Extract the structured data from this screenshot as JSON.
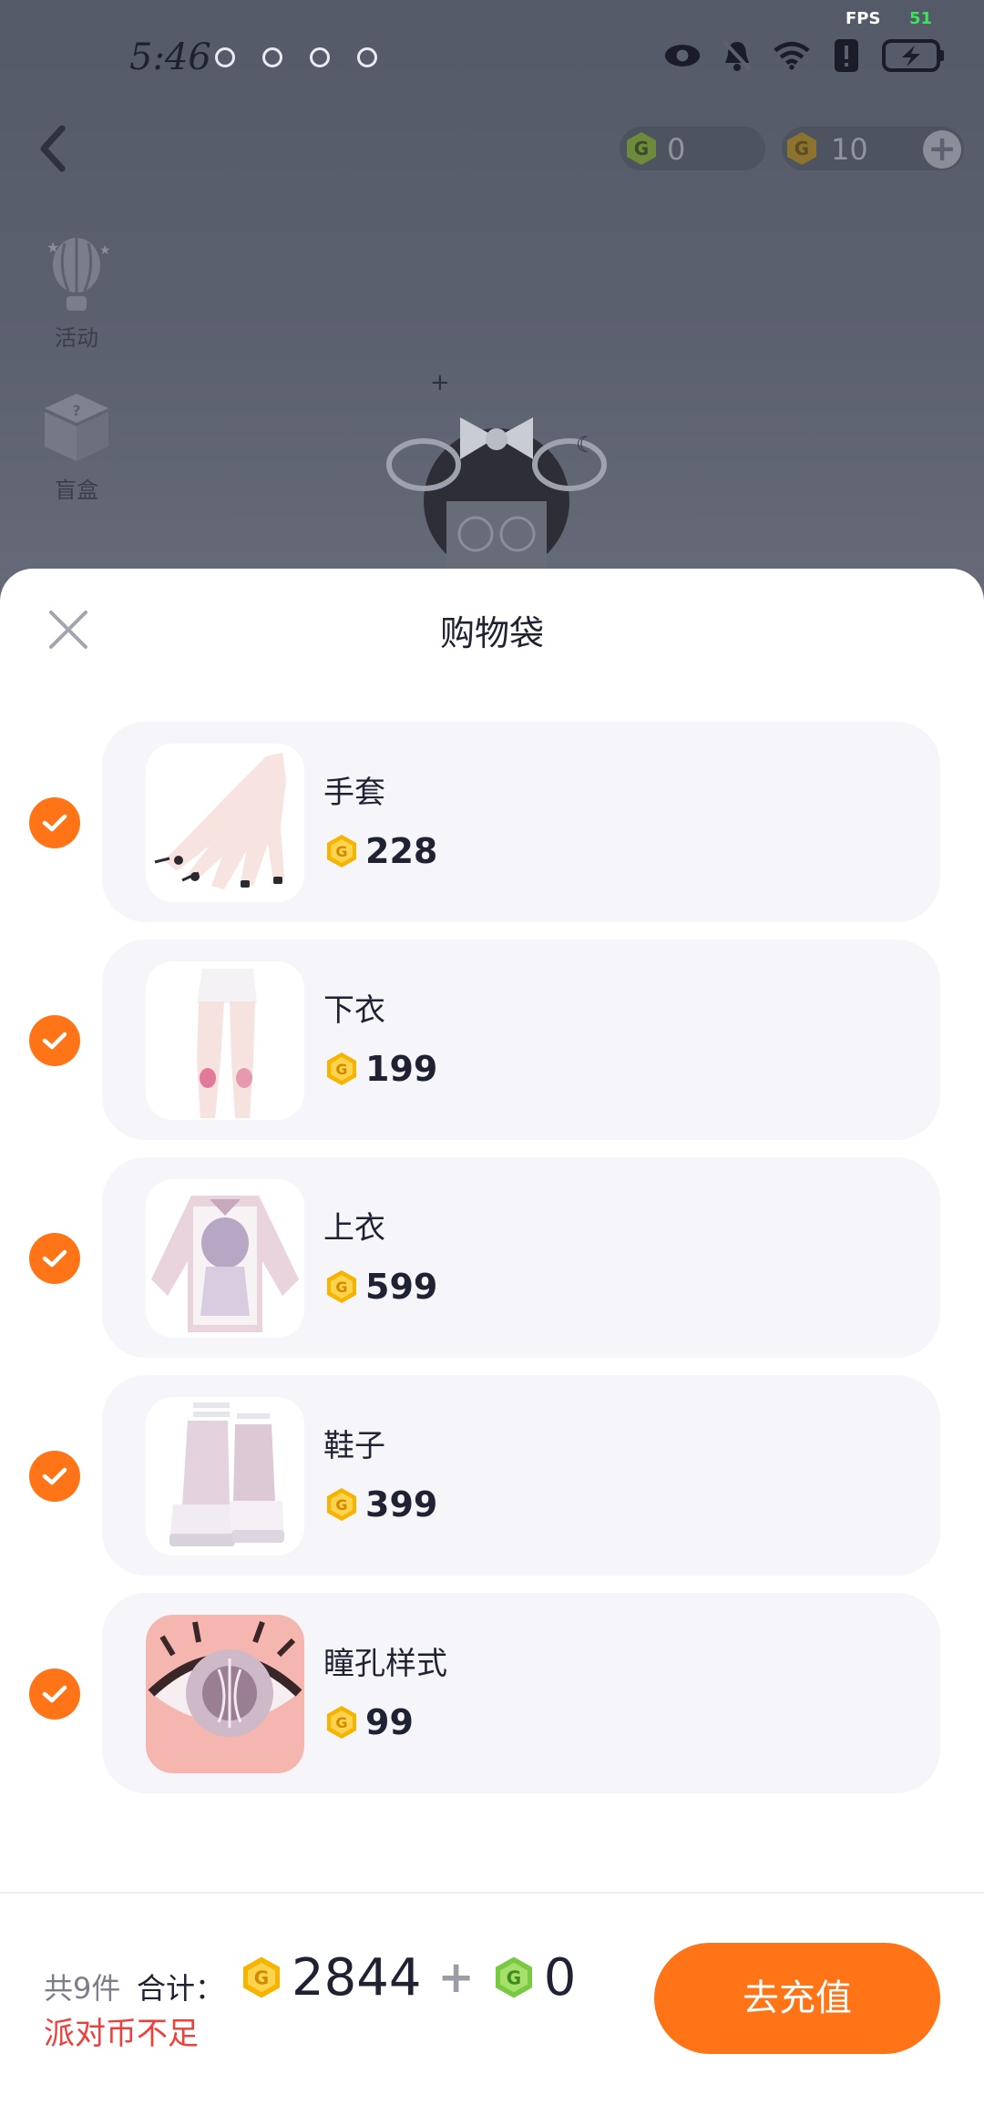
{
  "status_bar": {
    "fps_label": "FPS",
    "fps_value": "51",
    "time": "5:46"
  },
  "top_bar": {
    "currency_green": "0",
    "currency_gold": "10"
  },
  "side_menu": [
    {
      "label": "活动",
      "icon": "balloon-icon"
    },
    {
      "label": "盲盒",
      "icon": "mystery-box-icon"
    }
  ],
  "sheet": {
    "title": "购物袋",
    "items": [
      {
        "name": "手套",
        "price": "228",
        "checked": true,
        "thumb": "gloves"
      },
      {
        "name": "下衣",
        "price": "199",
        "checked": true,
        "thumb": "bottoms"
      },
      {
        "name": "上衣",
        "price": "599",
        "checked": true,
        "thumb": "top"
      },
      {
        "name": "鞋子",
        "price": "399",
        "checked": true,
        "thumb": "shoes"
      },
      {
        "name": "瞳孔样式",
        "price": "99",
        "checked": true,
        "thumb": "pupil"
      }
    ]
  },
  "footer": {
    "count_text": "共9件",
    "total_label": "合计：",
    "gold_total": "2844",
    "plus": "+",
    "green_total": "0",
    "warning": "派对币不足",
    "recharge_label": "去充值"
  },
  "colors": {
    "accent": "#ff7417",
    "warning": "#ee3f3a",
    "gold_coin": "#f6b400",
    "green_coin": "#7ac943"
  }
}
